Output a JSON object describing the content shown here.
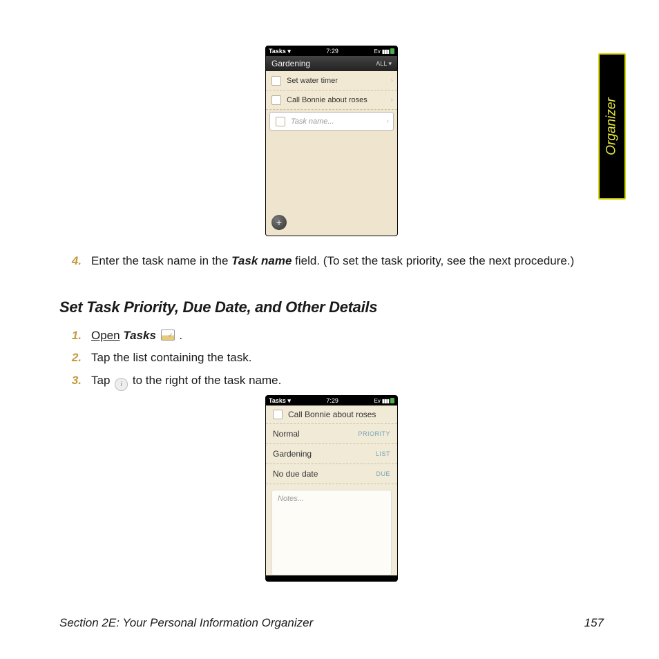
{
  "sidetab": {
    "label": "Organizer"
  },
  "fig1": {
    "status": {
      "app": "Tasks ▾",
      "time": "7:29"
    },
    "header": {
      "title": "Gardening",
      "filter": "ALL ▾"
    },
    "tasks": [
      {
        "label": "Set water timer"
      },
      {
        "label": "Call Bonnie about roses"
      }
    ],
    "input_placeholder": "Task name..."
  },
  "step4": {
    "num": "4.",
    "text_a": "Enter the task name in the ",
    "task_name_label": "Task name",
    "text_b": " field. (To set the task priority, see the next procedure.)"
  },
  "heading2": "Set Task Priority, Due Date, and Other Details",
  "steps": {
    "s1": {
      "num": "1.",
      "open": "Open",
      "tasks": "Tasks",
      "period": " ."
    },
    "s2": {
      "num": "2.",
      "text": "Tap the list containing the task."
    },
    "s3": {
      "num": "3.",
      "a": "Tap ",
      "b": " to the right of the task name."
    }
  },
  "fig2": {
    "status": {
      "app": "Tasks ▾",
      "time": "7:29"
    },
    "title": "Call Bonnie about roses",
    "rows": [
      {
        "val": "Normal",
        "lab": "PRIORITY"
      },
      {
        "val": "Gardening",
        "lab": "LIST"
      },
      {
        "val": "No due date",
        "lab": "DUE"
      }
    ],
    "notes_placeholder": "Notes..."
  },
  "footer": {
    "section": "Section 2E: Your Personal Information Organizer",
    "page": "157"
  }
}
